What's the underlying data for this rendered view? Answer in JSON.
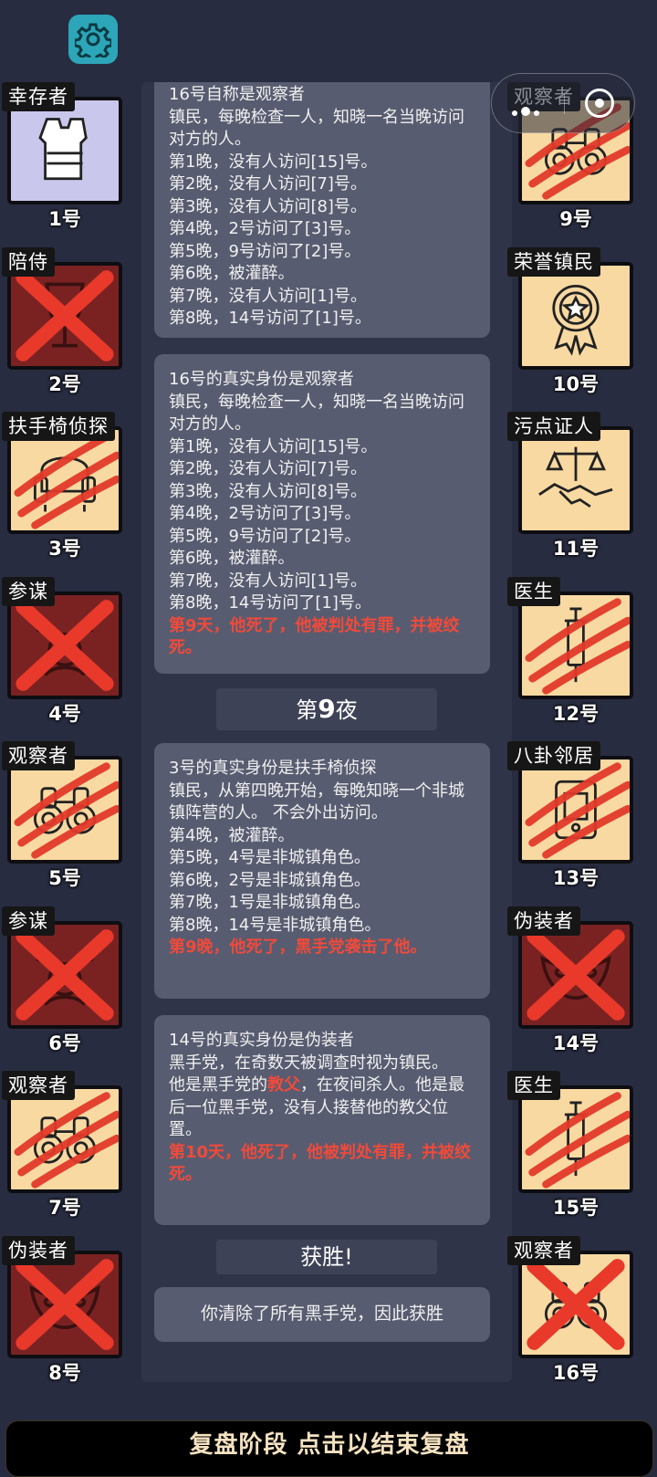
{
  "toolbar": {
    "settings_icon": "gear-icon",
    "more_icon": "more-dots-icon",
    "close_icon": "target-circle-icon"
  },
  "players_left": [
    {
      "number": "1号",
      "role": "幸存者",
      "status": "alive",
      "tile": "lav",
      "icon": "vest-icon"
    },
    {
      "number": "2号",
      "role": "陪侍",
      "status": "executed",
      "tile": "dead-red",
      "icon": "wine-glass-icon"
    },
    {
      "number": "3号",
      "role": "扶手椅侦探",
      "status": "killed",
      "tile": "alive",
      "icon": "armchair-icon"
    },
    {
      "number": "4号",
      "role": "参谋",
      "status": "executed",
      "tile": "dead-red",
      "icon": "advisor-icon"
    },
    {
      "number": "5号",
      "role": "观察者",
      "status": "killed",
      "tile": "alive",
      "icon": "binoculars-icon"
    },
    {
      "number": "6号",
      "role": "参谋",
      "status": "executed",
      "tile": "dead-red",
      "icon": "advisor-icon"
    },
    {
      "number": "7号",
      "role": "观察者",
      "status": "killed",
      "tile": "alive",
      "icon": "binoculars-icon"
    },
    {
      "number": "8号",
      "role": "伪装者",
      "status": "executed",
      "tile": "dead-red",
      "icon": "mask-icon"
    }
  ],
  "players_right": [
    {
      "number": "9号",
      "role": "观察者",
      "status": "killed",
      "tile": "alive",
      "icon": "binoculars-icon"
    },
    {
      "number": "10号",
      "role": "荣誉镇民",
      "status": "alive",
      "tile": "alive",
      "icon": "medal-icon"
    },
    {
      "number": "11号",
      "role": "污点证人",
      "status": "alive",
      "tile": "alive",
      "icon": "scales-handshake-icon"
    },
    {
      "number": "12号",
      "role": "医生",
      "status": "killed",
      "tile": "alive",
      "icon": "syringe-icon"
    },
    {
      "number": "13号",
      "role": "八卦邻居",
      "status": "killed",
      "tile": "alive",
      "icon": "gossip-icon"
    },
    {
      "number": "14号",
      "role": "伪装者",
      "status": "executed",
      "tile": "dead-red",
      "icon": "mask-icon"
    },
    {
      "number": "15号",
      "role": "医生",
      "status": "killed",
      "tile": "alive",
      "icon": "syringe-icon"
    },
    {
      "number": "16号",
      "role": "观察者",
      "status": "executed",
      "tile": "alive",
      "icon": "binoculars-icon"
    }
  ],
  "log": {
    "msg1": {
      "lines": [
        "16号自称是观察者",
        "镇民，每晚检查一人，知晓一名当晚访问对方的人。",
        "第1晚，没有人访问[15]号。",
        "第2晚，没有人访问[7]号。",
        "第3晚，没有人访问[8]号。",
        "第4晚，2号访问了[3]号。",
        "第5晚，9号访问了[2]号。",
        "第6晚，被灌醉。",
        "第7晚，没有人访问[1]号。",
        "第8晚，14号访问了[1]号。"
      ]
    },
    "msg2": {
      "lines": [
        "16号的真实身份是观察者",
        "镇民，每晚检查一人，知晓一名当晚访问对方的人。",
        "第1晚，没有人访问[15]号。",
        "第2晚，没有人访问[7]号。",
        "第3晚，没有人访问[8]号。",
        "第4晚，2号访问了[3]号。",
        "第5晚，9号访问了[2]号。",
        "第6晚，被灌醉。",
        "第7晚，没有人访问[1]号。",
        "第8晚，14号访问了[1]号。"
      ],
      "red": "第9天，他死了，他被判处有罪，并被绞死。"
    },
    "night_title_prefix": "第",
    "night_title_num": "9",
    "night_title_suffix": "夜",
    "msg3": {
      "lines": [
        "3号的真实身份是扶手椅侦探",
        "镇民，从第四晚开始，每晚知晓一个非城镇阵营的人。 不会外出访问。",
        "第4晚，被灌醉。",
        "第5晚，4号是非城镇角色。",
        "第6晚，2号是非城镇角色。",
        "第7晚，1号是非城镇角色。",
        "第8晚，14号是非城镇角色。"
      ],
      "red": "第9晚，他死了，黑手党袭击了他。"
    },
    "msg4": {
      "line1": "14号的真实身份是伪装者",
      "line2": "黑手党，在奇数天被调查时视为镇民。",
      "line3_pre": "他是黑手党的",
      "line3_red": "教父",
      "line3_post": "，在夜间杀人。他是最后一位黑手党，没有人接替他的教父位置。",
      "red": "第10天，他死了，他被判处有罪，并被绞死。"
    },
    "victory_title": "获胜!",
    "victory_text": "你清除了所有黑手党，因此获胜"
  },
  "bottom_bar": "复盘阶段 点击以结束复盘",
  "colors": {
    "background": "#282c40",
    "panel": "#2f3448",
    "bubble": "#585c70",
    "highlight": "#f04a3a",
    "tile": "#f8d9a2",
    "dead_tile": "#7a2222"
  }
}
